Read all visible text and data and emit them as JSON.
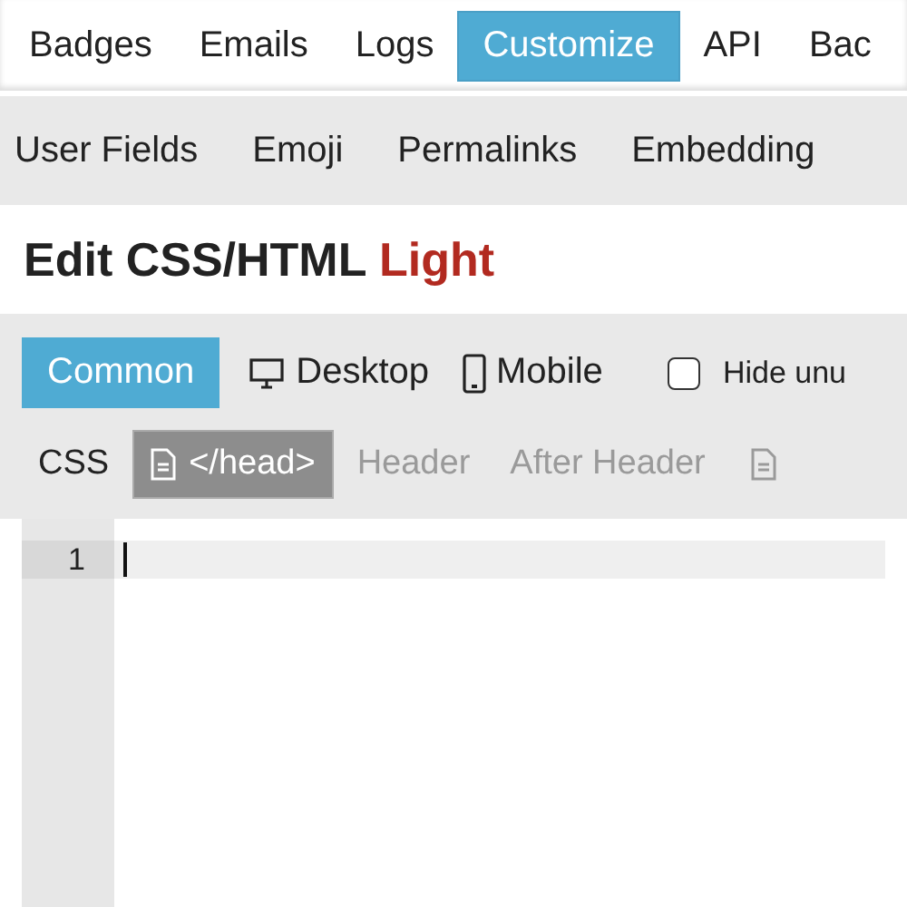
{
  "nav_tabs": [
    {
      "label": "Badges",
      "selected": false
    },
    {
      "label": "Emails",
      "selected": false
    },
    {
      "label": "Logs",
      "selected": false
    },
    {
      "label": "Customize",
      "selected": true
    },
    {
      "label": "API",
      "selected": false
    },
    {
      "label": "Bac",
      "selected": false
    }
  ],
  "sub_nav": [
    {
      "label": "User Fields"
    },
    {
      "label": "Emoji"
    },
    {
      "label": "Permalinks"
    },
    {
      "label": "Embedding"
    }
  ],
  "heading": {
    "text": "Edit CSS/HTML",
    "theme": "Light"
  },
  "targets": [
    {
      "label": "Common",
      "selected": true,
      "kind": "plain"
    },
    {
      "label": "Desktop",
      "selected": false,
      "kind": "desktop"
    },
    {
      "label": "Mobile",
      "selected": false,
      "kind": "mobile"
    }
  ],
  "hide_unused": {
    "label": "Hide unu",
    "checked": false
  },
  "fields": [
    {
      "label": "CSS",
      "selected": false,
      "muted": false,
      "kind": "text"
    },
    {
      "label": "</head>",
      "selected": true,
      "muted": false,
      "kind": "file"
    },
    {
      "label": "Header",
      "selected": false,
      "muted": true,
      "kind": "text"
    },
    {
      "label": "After Header",
      "selected": false,
      "muted": true,
      "kind": "text"
    },
    {
      "selected": false,
      "muted": true,
      "kind": "icon"
    }
  ],
  "editor": {
    "line_numbers": [
      "1"
    ]
  }
}
